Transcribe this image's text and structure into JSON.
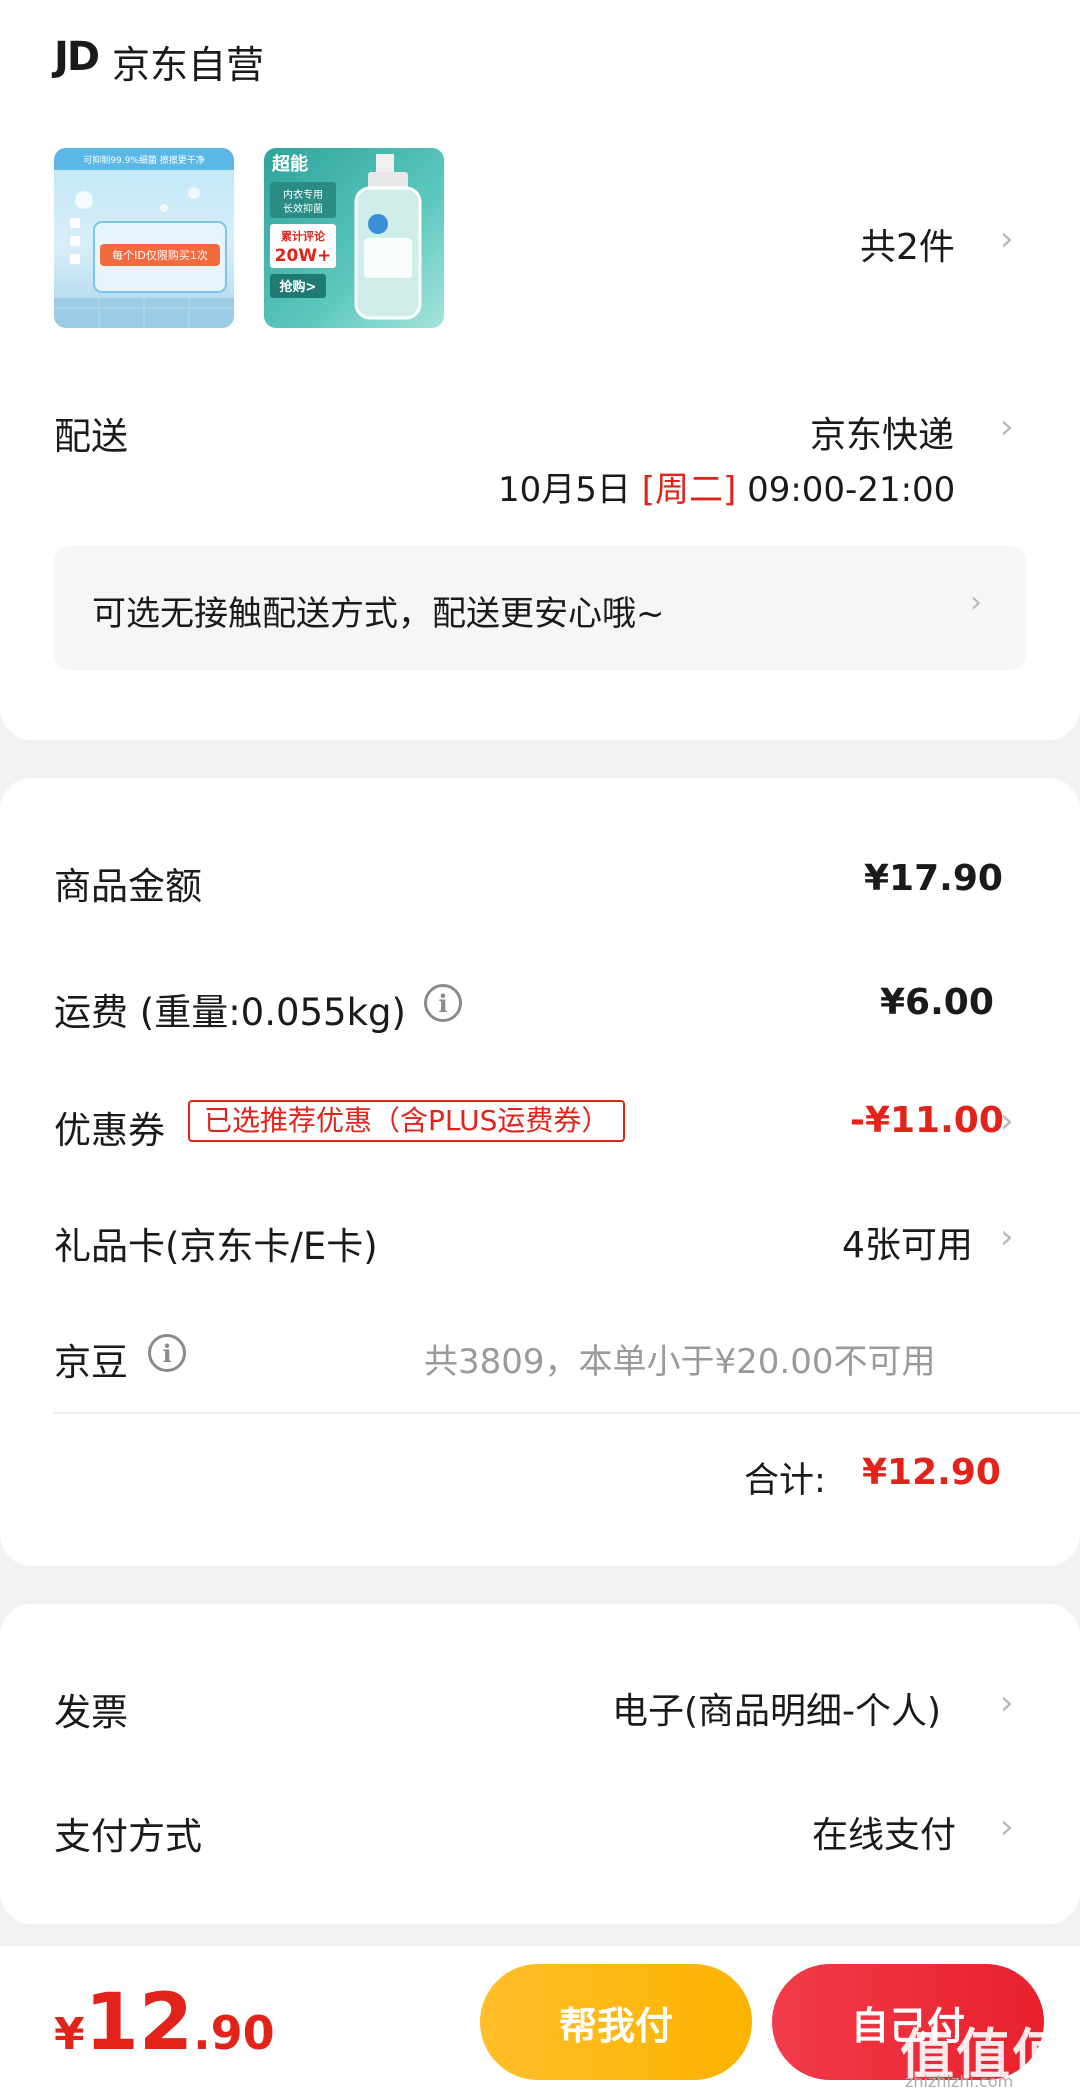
{
  "store": {
    "logo": "JD",
    "name": "京东自营"
  },
  "items": {
    "thumb1": {
      "top_text": "可抑制99.9%细菌 擦擦更干净",
      "banner": "每个ID仅限购买1次"
    },
    "thumb2": {
      "brand": "超能",
      "tag": "内衣专用\n长效抑菌",
      "review_label": "累计评论",
      "review_count": "20W+",
      "buy": "抢购>"
    },
    "count_label": "共2件"
  },
  "delivery": {
    "label": "配送",
    "carrier": "京东快递",
    "date": "10月5日",
    "weekday": "[周二]",
    "time": "09:00-21:00",
    "tip": "可选无接触配送方式，配送更安心哦~"
  },
  "summary": {
    "goods_label": "商品金额",
    "goods_value": "¥17.90",
    "shipping_label": "运费 (重量:0.055kg)",
    "shipping_value": "¥6.00",
    "coupon_label": "优惠券",
    "coupon_badge": "已选推荐优惠（含PLUS运费券）",
    "coupon_value": "-¥11.00",
    "giftcard_label": "礼品卡(京东卡/E卡)",
    "giftcard_value": "4张可用",
    "beans_label": "京豆",
    "beans_value": "共3809，本单小于¥20.00不可用",
    "total_label": "合计:",
    "total_value": "¥12.90"
  },
  "invoice": {
    "label": "发票",
    "value": "电子(商品明细-个人)"
  },
  "payment": {
    "label": "支付方式",
    "value": "在线支付"
  },
  "bottom": {
    "currency": "¥",
    "price_int": "12",
    "price_dec": ".90",
    "help_pay": "帮我付",
    "self_pay": "自己付",
    "watermark": "值值值",
    "watermark_sub": "zhizhizhi.com"
  },
  "colors": {
    "accent_red": "#e2231a",
    "help_pay": "#fbb300",
    "self_pay": "#e8202c"
  },
  "icons": {
    "chevron": "chevron-right-icon",
    "info": "info-icon"
  }
}
